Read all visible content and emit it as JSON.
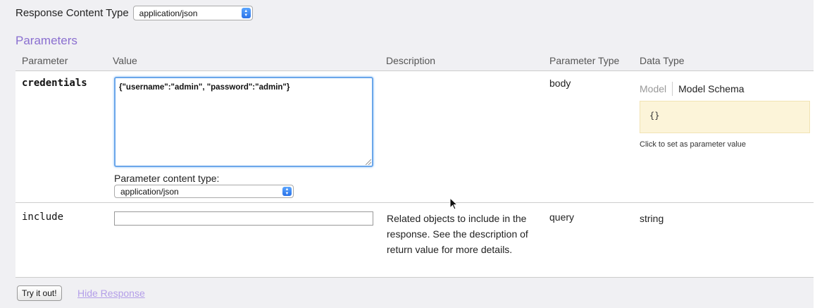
{
  "response_content_type": {
    "label": "Response Content Type",
    "selected": "application/json"
  },
  "parameters": {
    "heading": "Parameters",
    "columns": [
      "Parameter",
      "Value",
      "Description",
      "Parameter Type",
      "Data Type"
    ],
    "rows": [
      {
        "name": "credentials",
        "value": "{\"username\":\"admin\", \"password\":\"admin\"}",
        "content_type_label": "Parameter content type:",
        "content_type_selected": "application/json",
        "description": "",
        "param_type": "body",
        "data_type": {
          "tabs": [
            "Model",
            "Model Schema"
          ],
          "schema": "{}",
          "hint": "Click to set as parameter value"
        }
      },
      {
        "name": "include",
        "value": "",
        "description": "Related objects to include in the response. See the description of return value for more details.",
        "param_type": "query",
        "data_type": "string"
      }
    ]
  },
  "actions": {
    "try_button": "Try it out!",
    "hide_response_link": "Hide Response"
  },
  "colors": {
    "heading_purple": "#8a6fd0",
    "link_purple": "#b39ee8",
    "schema_bg": "#fcf4d9",
    "focus_blue": "#6aa6ea"
  }
}
